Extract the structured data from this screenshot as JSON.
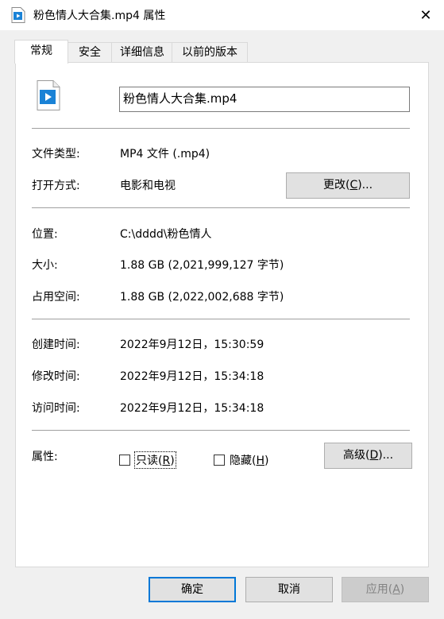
{
  "window": {
    "title": "粉色情人大合集.mp4 属性",
    "close_glyph": "✕"
  },
  "tabs": [
    {
      "label": "常规"
    },
    {
      "label": "安全"
    },
    {
      "label": "详细信息"
    },
    {
      "label": "以前的版本"
    }
  ],
  "general": {
    "file_name": "粉色情人大合集.mp4",
    "rows": {
      "file_type": {
        "label": "文件类型:",
        "value": "MP4 文件 (.mp4)"
      },
      "open_with": {
        "label": "打开方式:",
        "value": "电影和电视"
      },
      "location": {
        "label": "位置:",
        "value": "C:\\dddd\\粉色情人"
      },
      "size": {
        "label": "大小:",
        "value": "1.88 GB (2,021,999,127 字节)"
      },
      "size_on_disk": {
        "label": "占用空间:",
        "value": "1.88 GB (2,022,002,688 字节)"
      },
      "created": {
        "label": "创建时间:",
        "value": "2022年9月12日，15:30:59"
      },
      "modified": {
        "label": "修改时间:",
        "value": "2022年9月12日，15:34:18"
      },
      "accessed": {
        "label": "访问时间:",
        "value": "2022年9月12日，15:34:18"
      },
      "attributes": {
        "label": "属性:"
      }
    },
    "change_button": {
      "text": "更改(",
      "key": "C",
      "tail": ")..."
    },
    "readonly": {
      "text": "只读(",
      "key": "R",
      "tail": ")",
      "checked": false
    },
    "hidden": {
      "text": "隐藏(",
      "key": "H",
      "tail": ")",
      "checked": false
    },
    "advanced_button": {
      "text": "高级(",
      "key": "D",
      "tail": ")..."
    }
  },
  "footer": {
    "ok": "确定",
    "cancel": "取消",
    "apply": {
      "text": "应用(",
      "key": "A",
      "tail": ")"
    }
  },
  "icons": {
    "title_icon": "video-file-icon",
    "file_icon": "video-file-icon",
    "accent": "#1a82d6"
  }
}
